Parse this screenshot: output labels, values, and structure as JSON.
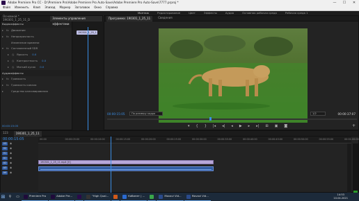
{
  "window": {
    "title": "Adobe Premiere Pro CC - D:\\Premiere Pro\\Adobe Premiere Pro Auto-Save\\Adobe Premiere Pro Auto-Save\\7777.prproj *",
    "minimize_glyph": "—",
    "maximize_glyph": "☐",
    "close_glyph": "✕"
  },
  "menu": [
    "Файл",
    "Изменить",
    "Клип",
    "Эпизод",
    "Маркер",
    "Заголовок",
    "Окно",
    "Справка"
  ],
  "workspaces": [
    "Монтаж",
    "Редактирование",
    "Цвет",
    "Эффекты",
    "Аудио",
    "Основная рабочая среда",
    "Рабочая среда 1"
  ],
  "effects_panel": {
    "tabs": [
      "Основной * 190301_1_25_11_D",
      "Элементы управления эффектами"
    ],
    "clip_bar_label": "190301_1_25_1...",
    "rows": [
      {
        "label": "Видеоэффекты",
        "type": "section"
      },
      {
        "label": "Движение",
        "type": "effect",
        "arrow": "▸",
        "stop": "fx"
      },
      {
        "label": "Непрозрачность",
        "type": "effect",
        "arrow": "▸",
        "stop": "fx"
      },
      {
        "label": "Изменение времени",
        "type": "effect",
        "arrow": "",
        "stop": ""
      },
      {
        "label": "Составленный SDR",
        "type": "effect",
        "arrow": "▾",
        "stop": "fx"
      },
      {
        "label": "Яркость",
        "type": "param",
        "arrow": "▸",
        "stop": "◷",
        "value": "0.0"
      },
      {
        "label": "Контрастность",
        "type": "param",
        "arrow": "▸",
        "stop": "◷",
        "value": "0.0"
      },
      {
        "label": "Мягкий кусок",
        "type": "param",
        "arrow": "▸",
        "stop": "◷",
        "value": "0.0"
      },
      {
        "label": "Аудиоэффекты",
        "type": "section"
      },
      {
        "label": "Громкость",
        "type": "effect",
        "arrow": "▸",
        "stop": "fx"
      },
      {
        "label": "Громкость канала",
        "type": "effect",
        "arrow": "▸",
        "stop": "fx"
      },
      {
        "label": "Средство кансовирования",
        "type": "effect",
        "arrow": "▸",
        "stop": ""
      }
    ],
    "timecode": "00:00:15:05"
  },
  "program_monitor": {
    "tabs": [
      "Программа: 190301_1_25_11",
      "Сведения"
    ],
    "timecode_current": "00:00:15:05",
    "timecode_total": "00:00:37:07",
    "fit_label": "По размеру кадра",
    "resolution_label": "1/2",
    "transport": [
      "▾",
      "{",
      "}",
      "|◂",
      "◂|",
      "◂",
      "▶",
      "▸",
      "▸|",
      "⊞",
      "▣",
      "◙"
    ],
    "add_button": "+"
  },
  "timeline": {
    "tabs": [
      "123",
      "190301_1_25_11"
    ],
    "timecode": "00:00:15:05",
    "ruler": [
      "00:00",
      "00:00:05:00",
      "00:00:10:00",
      "00:00:15:00",
      "00:00:20:00",
      "00:00:25:00",
      "00:00:30:00",
      "00:00:35:00",
      "00:00:40:00",
      "00:00:45:00",
      "00:00:50:00",
      "00:00:55:00",
      "00:01:00:00"
    ],
    "tracks": [
      "V3",
      "V2",
      "V1",
      "A1",
      "A2",
      "A3",
      "A4"
    ],
    "video_clip_label": "190301_1_25_11.mp4 [V]"
  },
  "taskbar": {
    "apps": [
      {
        "label": "Premiere Pro",
        "color": "#1f0a3a"
      },
      {
        "label": "Adobe Pre...",
        "color": "#1f0a3a"
      },
      {
        "label": "",
        "color": "#2a0a4a"
      },
      {
        "label": "\"High Qual...",
        "color": "#333"
      },
      {
        "label": "",
        "color": "#d05a1a"
      },
      {
        "label": "Кабинет | ...",
        "color": "#2a6ad0"
      },
      {
        "label": "",
        "color": "#3aa64a"
      },
      {
        "label": "Movavi Vid...",
        "color": "#2a4a8a"
      },
      {
        "label": "Movavi Vid...",
        "color": "#2a4a8a"
      }
    ],
    "time": "14:53",
    "date": "10.04.2021"
  }
}
